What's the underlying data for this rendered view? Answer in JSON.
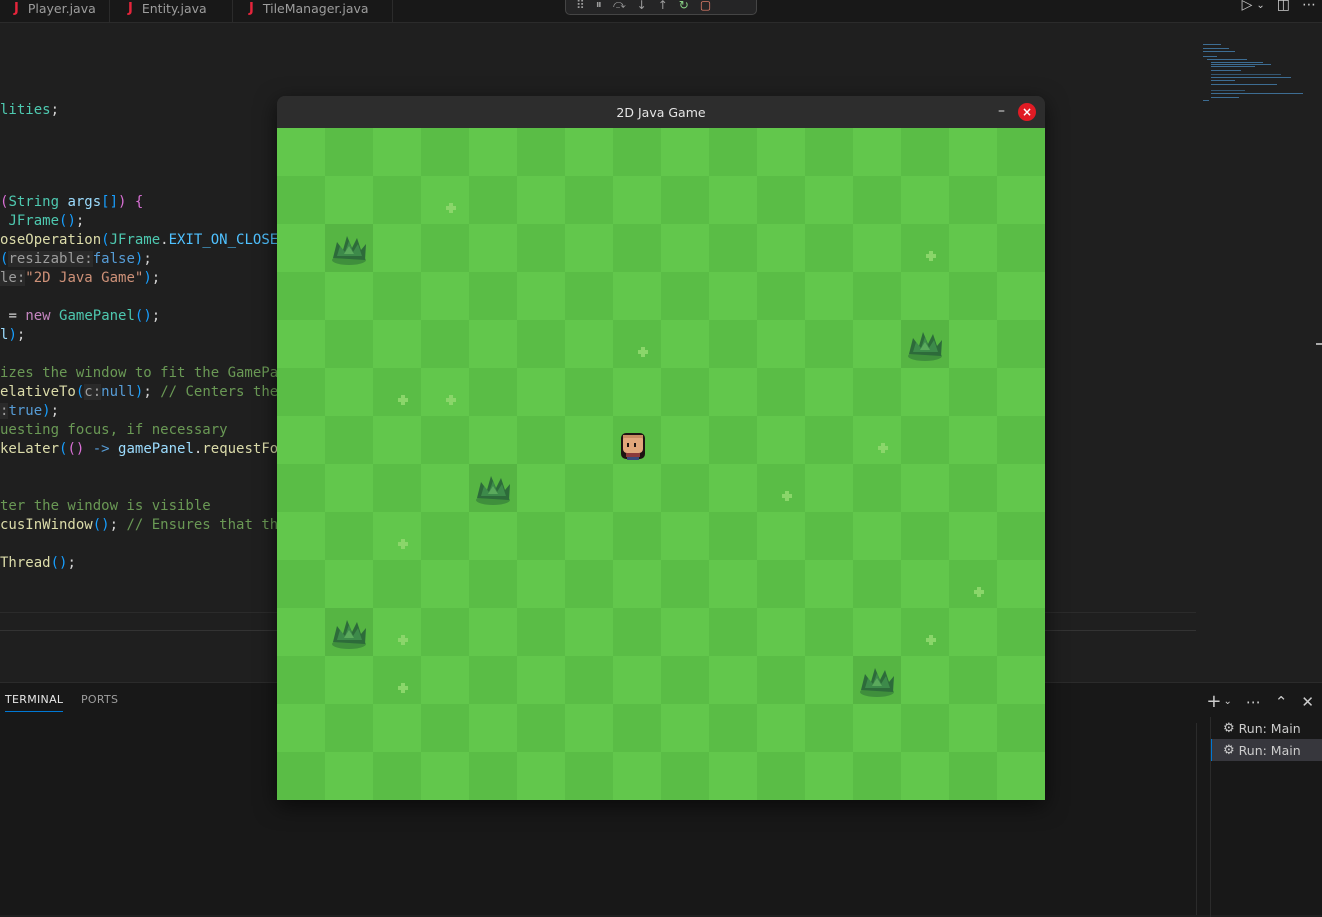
{
  "tabs": [
    {
      "icon": "J",
      "label": "Player.java"
    },
    {
      "icon": "J",
      "label": "Entity.java"
    },
    {
      "icon": "J",
      "label": "TileManager.java"
    }
  ],
  "panel": {
    "tab_terminal": "TERMINAL",
    "tab_ports": "PORTS",
    "terminals": [
      {
        "label": "Run: Main"
      },
      {
        "label": "Run: Main"
      }
    ]
  },
  "game_window": {
    "title": "2D Java Game",
    "tile_colors": {
      "light": "#62c74c",
      "dark": "#5abd46",
      "sprout": "#8ad66a",
      "bush_dark": "#2d6b3a",
      "bush_mid": "#3d8a4a",
      "bush_light": "#5aa95c"
    },
    "grid": {
      "cols": 16,
      "rows": 14
    },
    "bushes": [
      [
        1,
        2
      ],
      [
        13,
        4
      ],
      [
        4,
        7
      ],
      [
        1,
        10
      ],
      [
        12,
        11
      ]
    ],
    "sprouts": [
      [
        3,
        1
      ],
      [
        13,
        2
      ],
      [
        7,
        4
      ],
      [
        2,
        5
      ],
      [
        3,
        5
      ],
      [
        12,
        6
      ],
      [
        10,
        7
      ],
      [
        2,
        8
      ],
      [
        14,
        9
      ],
      [
        2,
        10
      ],
      [
        13,
        10
      ],
      [
        2,
        11
      ]
    ],
    "player": {
      "col": 7,
      "row": 6
    }
  },
  "colors": {
    "accent": "#0078d4",
    "java_icon": "#e5243b",
    "close_button": "#e01b24"
  }
}
